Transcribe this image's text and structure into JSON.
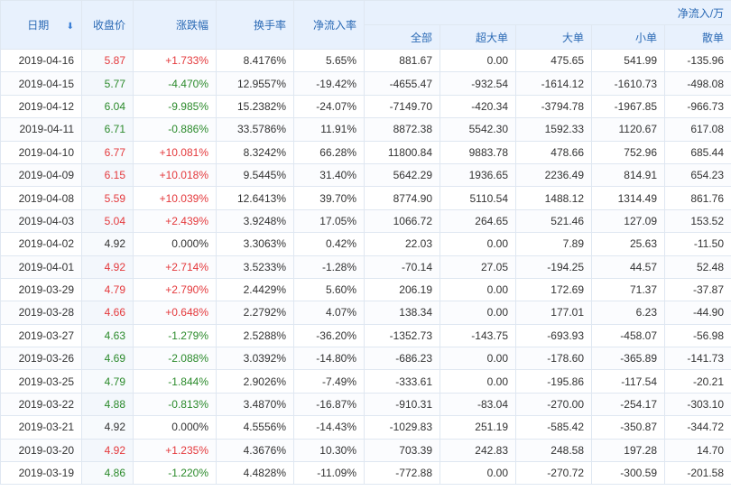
{
  "header": {
    "date": "日期",
    "close": "收盘价",
    "change": "涨跌幅",
    "turnover": "换手率",
    "net_ratio": "净流入率",
    "group": "净流入/万",
    "all": "全部",
    "super_large": "超大单",
    "large": "大单",
    "small": "小单",
    "retail": "散单"
  },
  "colors": {
    "up": "#e4393c",
    "down": "#2b8a2b",
    "flat": "#333333",
    "header_bg": "#e8f1fd",
    "header_text": "#2b6ab5"
  },
  "icons": {
    "sort": "sort-down-arrow-icon"
  },
  "rows": [
    {
      "date": "2019-04-16",
      "close": "5.87",
      "change": "+1.733%",
      "turnover": "8.4176%",
      "net_ratio": "5.65%",
      "all": "881.67",
      "super_large": "0.00",
      "large": "475.65",
      "small": "541.99",
      "retail": "-135.96",
      "trend": "up"
    },
    {
      "date": "2019-04-15",
      "close": "5.77",
      "change": "-4.470%",
      "turnover": "12.9557%",
      "net_ratio": "-19.42%",
      "all": "-4655.47",
      "super_large": "-932.54",
      "large": "-1614.12",
      "small": "-1610.73",
      "retail": "-498.08",
      "trend": "down"
    },
    {
      "date": "2019-04-12",
      "close": "6.04",
      "change": "-9.985%",
      "turnover": "15.2382%",
      "net_ratio": "-24.07%",
      "all": "-7149.70",
      "super_large": "-420.34",
      "large": "-3794.78",
      "small": "-1967.85",
      "retail": "-966.73",
      "trend": "down"
    },
    {
      "date": "2019-04-11",
      "close": "6.71",
      "change": "-0.886%",
      "turnover": "33.5786%",
      "net_ratio": "11.91%",
      "all": "8872.38",
      "super_large": "5542.30",
      "large": "1592.33",
      "small": "1120.67",
      "retail": "617.08",
      "trend": "down"
    },
    {
      "date": "2019-04-10",
      "close": "6.77",
      "change": "+10.081%",
      "turnover": "8.3242%",
      "net_ratio": "66.28%",
      "all": "11800.84",
      "super_large": "9883.78",
      "large": "478.66",
      "small": "752.96",
      "retail": "685.44",
      "trend": "up"
    },
    {
      "date": "2019-04-09",
      "close": "6.15",
      "change": "+10.018%",
      "turnover": "9.5445%",
      "net_ratio": "31.40%",
      "all": "5642.29",
      "super_large": "1936.65",
      "large": "2236.49",
      "small": "814.91",
      "retail": "654.23",
      "trend": "up"
    },
    {
      "date": "2019-04-08",
      "close": "5.59",
      "change": "+10.039%",
      "turnover": "12.6413%",
      "net_ratio": "39.70%",
      "all": "8774.90",
      "super_large": "5110.54",
      "large": "1488.12",
      "small": "1314.49",
      "retail": "861.76",
      "trend": "up"
    },
    {
      "date": "2019-04-03",
      "close": "5.04",
      "change": "+2.439%",
      "turnover": "3.9248%",
      "net_ratio": "17.05%",
      "all": "1066.72",
      "super_large": "264.65",
      "large": "521.46",
      "small": "127.09",
      "retail": "153.52",
      "trend": "up"
    },
    {
      "date": "2019-04-02",
      "close": "4.92",
      "change": "0.000%",
      "turnover": "3.3063%",
      "net_ratio": "0.42%",
      "all": "22.03",
      "super_large": "0.00",
      "large": "7.89",
      "small": "25.63",
      "retail": "-11.50",
      "trend": "flat"
    },
    {
      "date": "2019-04-01",
      "close": "4.92",
      "change": "+2.714%",
      "turnover": "3.5233%",
      "net_ratio": "-1.28%",
      "all": "-70.14",
      "super_large": "27.05",
      "large": "-194.25",
      "small": "44.57",
      "retail": "52.48",
      "trend": "up"
    },
    {
      "date": "2019-03-29",
      "close": "4.79",
      "change": "+2.790%",
      "turnover": "2.4429%",
      "net_ratio": "5.60%",
      "all": "206.19",
      "super_large": "0.00",
      "large": "172.69",
      "small": "71.37",
      "retail": "-37.87",
      "trend": "up"
    },
    {
      "date": "2019-03-28",
      "close": "4.66",
      "change": "+0.648%",
      "turnover": "2.2792%",
      "net_ratio": "4.07%",
      "all": "138.34",
      "super_large": "0.00",
      "large": "177.01",
      "small": "6.23",
      "retail": "-44.90",
      "trend": "up"
    },
    {
      "date": "2019-03-27",
      "close": "4.63",
      "change": "-1.279%",
      "turnover": "2.5288%",
      "net_ratio": "-36.20%",
      "all": "-1352.73",
      "super_large": "-143.75",
      "large": "-693.93",
      "small": "-458.07",
      "retail": "-56.98",
      "trend": "down"
    },
    {
      "date": "2019-03-26",
      "close": "4.69",
      "change": "-2.088%",
      "turnover": "3.0392%",
      "net_ratio": "-14.80%",
      "all": "-686.23",
      "super_large": "0.00",
      "large": "-178.60",
      "small": "-365.89",
      "retail": "-141.73",
      "trend": "down"
    },
    {
      "date": "2019-03-25",
      "close": "4.79",
      "change": "-1.844%",
      "turnover": "2.9026%",
      "net_ratio": "-7.49%",
      "all": "-333.61",
      "super_large": "0.00",
      "large": "-195.86",
      "small": "-117.54",
      "retail": "-20.21",
      "trend": "down"
    },
    {
      "date": "2019-03-22",
      "close": "4.88",
      "change": "-0.813%",
      "turnover": "3.4870%",
      "net_ratio": "-16.87%",
      "all": "-910.31",
      "super_large": "-83.04",
      "large": "-270.00",
      "small": "-254.17",
      "retail": "-303.10",
      "trend": "down"
    },
    {
      "date": "2019-03-21",
      "close": "4.92",
      "change": "0.000%",
      "turnover": "4.5556%",
      "net_ratio": "-14.43%",
      "all": "-1029.83",
      "super_large": "251.19",
      "large": "-585.42",
      "small": "-350.87",
      "retail": "-344.72",
      "trend": "flat"
    },
    {
      "date": "2019-03-20",
      "close": "4.92",
      "change": "+1.235%",
      "turnover": "4.3676%",
      "net_ratio": "10.30%",
      "all": "703.39",
      "super_large": "242.83",
      "large": "248.58",
      "small": "197.28",
      "retail": "14.70",
      "trend": "up"
    },
    {
      "date": "2019-03-19",
      "close": "4.86",
      "change": "-1.220%",
      "turnover": "4.4828%",
      "net_ratio": "-11.09%",
      "all": "-772.88",
      "super_large": "0.00",
      "large": "-270.72",
      "small": "-300.59",
      "retail": "-201.58",
      "trend": "down"
    }
  ]
}
